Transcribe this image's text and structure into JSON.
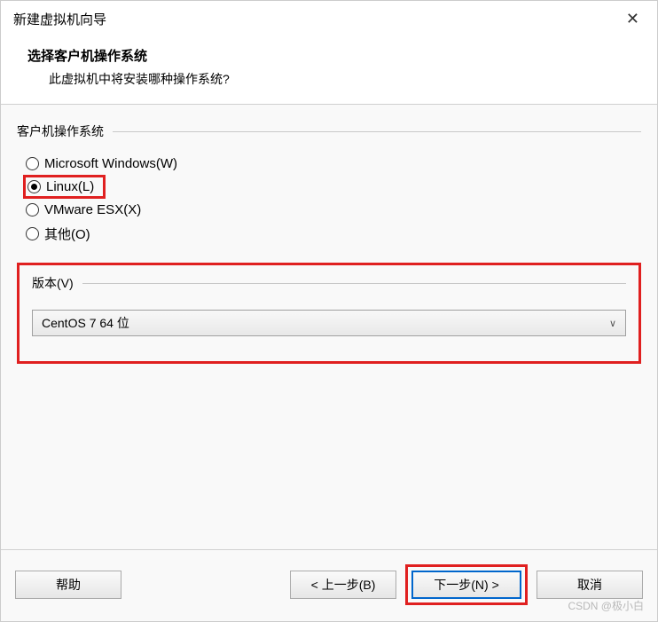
{
  "window": {
    "title": "新建虚拟机向导"
  },
  "header": {
    "title": "选择客户机操作系统",
    "subtitle": "此虚拟机中将安装哪种操作系统?"
  },
  "os_group": {
    "label": "客户机操作系统",
    "options": [
      {
        "label": "Microsoft Windows(W)",
        "checked": false
      },
      {
        "label": "Linux(L)",
        "checked": true
      },
      {
        "label": "VMware ESX(X)",
        "checked": false
      },
      {
        "label": "其他(O)",
        "checked": false
      }
    ]
  },
  "version": {
    "label": "版本(V)",
    "selected": "CentOS 7 64 位"
  },
  "buttons": {
    "help": "帮助",
    "back": "< 上一步(B)",
    "next": "下一步(N) >",
    "cancel": "取消"
  },
  "watermark": "CSDN @极小白"
}
